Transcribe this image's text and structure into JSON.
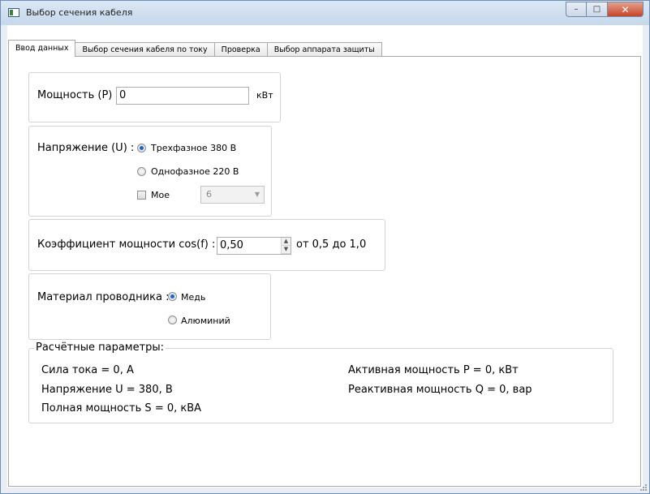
{
  "window": {
    "title": "Выбор сечения кабеля",
    "controls": {
      "minimize": "–",
      "maximize": "□",
      "close": "✕"
    }
  },
  "tabs": [
    {
      "label": "Ввод данных",
      "active": true
    },
    {
      "label": "Выбор сечения кабеля по току",
      "active": false
    },
    {
      "label": "Проверка",
      "active": false
    },
    {
      "label": "Выбор аппарата защиты",
      "active": false
    }
  ],
  "power": {
    "label": "Мощность (P)",
    "value": "0",
    "unit": "кВт"
  },
  "voltage": {
    "label": "Напряжение (U) :",
    "options": [
      {
        "label": "Трехфазное 380 В",
        "selected": true
      },
      {
        "label": "Однофазное 220 В",
        "selected": false
      }
    ],
    "custom": {
      "label": "Мое",
      "checked": false,
      "value": "6"
    }
  },
  "power_factor": {
    "label": "Коэффициент мощности cos(f) :",
    "value": "0,50",
    "range": "от 0,5 до 1,0"
  },
  "material": {
    "label": "Материал проводника :",
    "options": [
      {
        "label": "Медь",
        "selected": true
      },
      {
        "label": "Алюминий",
        "selected": false
      }
    ]
  },
  "calculated": {
    "legend": "Расчётные параметры:",
    "current": "Сила тока =  0, А",
    "voltage": "Напряжение U =   380, В",
    "apparent_power": "Полная мощность S =  0, кВА",
    "active_power": "Активная мощность P =   0, кВт",
    "reactive_power": "Реактивная мощность Q =  0, вар"
  },
  "colors": {
    "accent": "#1b64c8",
    "close_button": "#c7452a"
  }
}
